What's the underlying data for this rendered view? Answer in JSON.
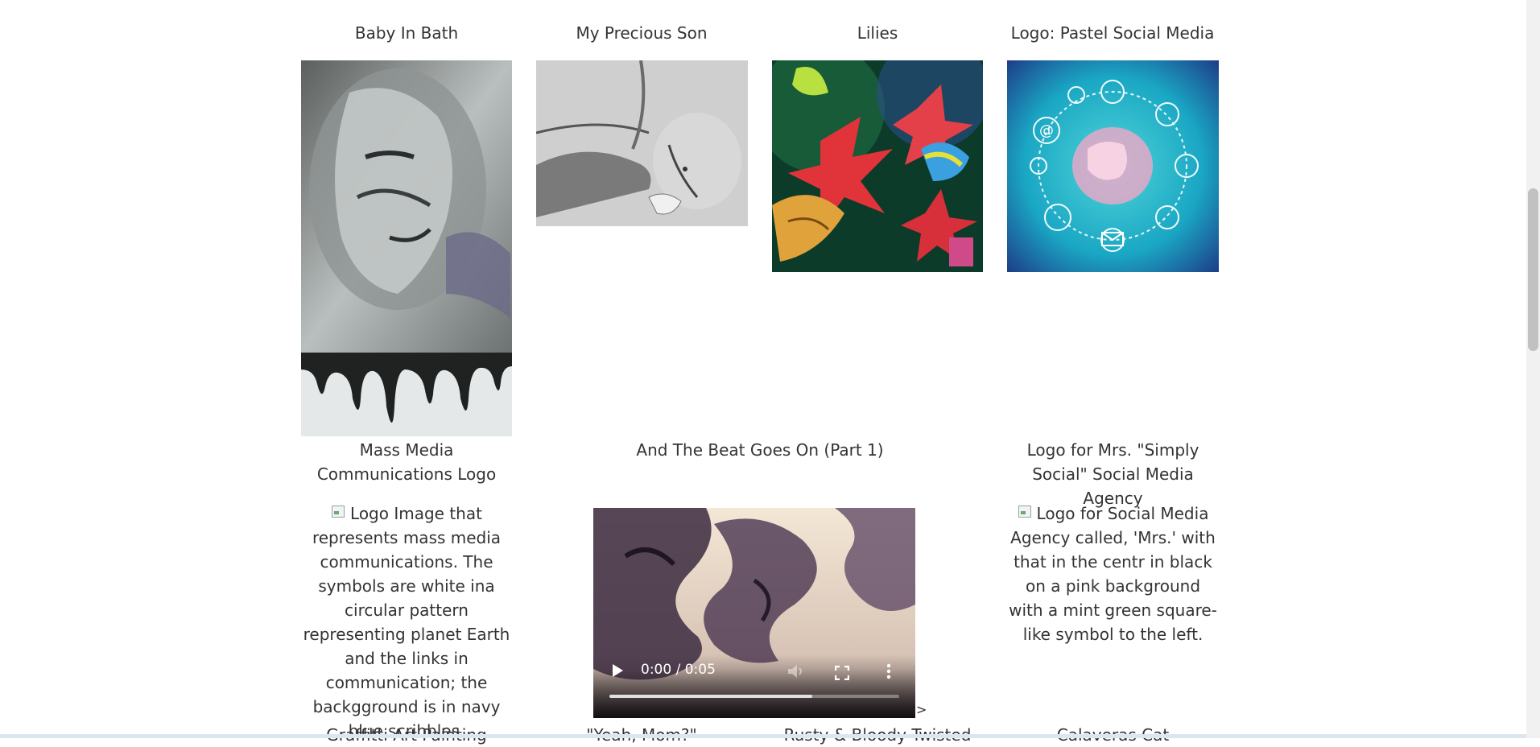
{
  "gallery": {
    "row1": [
      {
        "title": "Baby In Bath"
      },
      {
        "title": "My Precious Son"
      },
      {
        "title": "Lilies"
      },
      {
        "title": "Logo: Pastel Social Media"
      }
    ],
    "row2": [
      {
        "title": "Mass Media Communications Logo",
        "alt": "Logo Image that represents mass media communications. The symbols are white ina circular pattern representing planet Earth and the links in communication; the backgground is in navy blue scribbles."
      },
      {
        "title": "And The Beat Goes On (Part 1)",
        "video_time": "0:00 / 0:05",
        "video_progress": 0,
        "video_buffered": 0.7,
        "stray_text": ">"
      },
      {
        "title": "Logo for Mrs. \"Simply Social\" Social Media Agency",
        "alt": "Logo for Social Media Agency called, 'Mrs.' with that in the centr in black on a pink background with a mint green square-like symbol to the left."
      }
    ],
    "row3": [
      {
        "title": "Graffitti Art Painting"
      },
      {
        "title": "\"Yeah, Mom?\""
      },
      {
        "title": "Rusty & Bloody Twisted"
      },
      {
        "title": "Calaveras Cat"
      }
    ]
  },
  "colors": {
    "text": "#333333",
    "background": "#ffffff",
    "scrollbar_thumb": "#c1c1c1"
  }
}
